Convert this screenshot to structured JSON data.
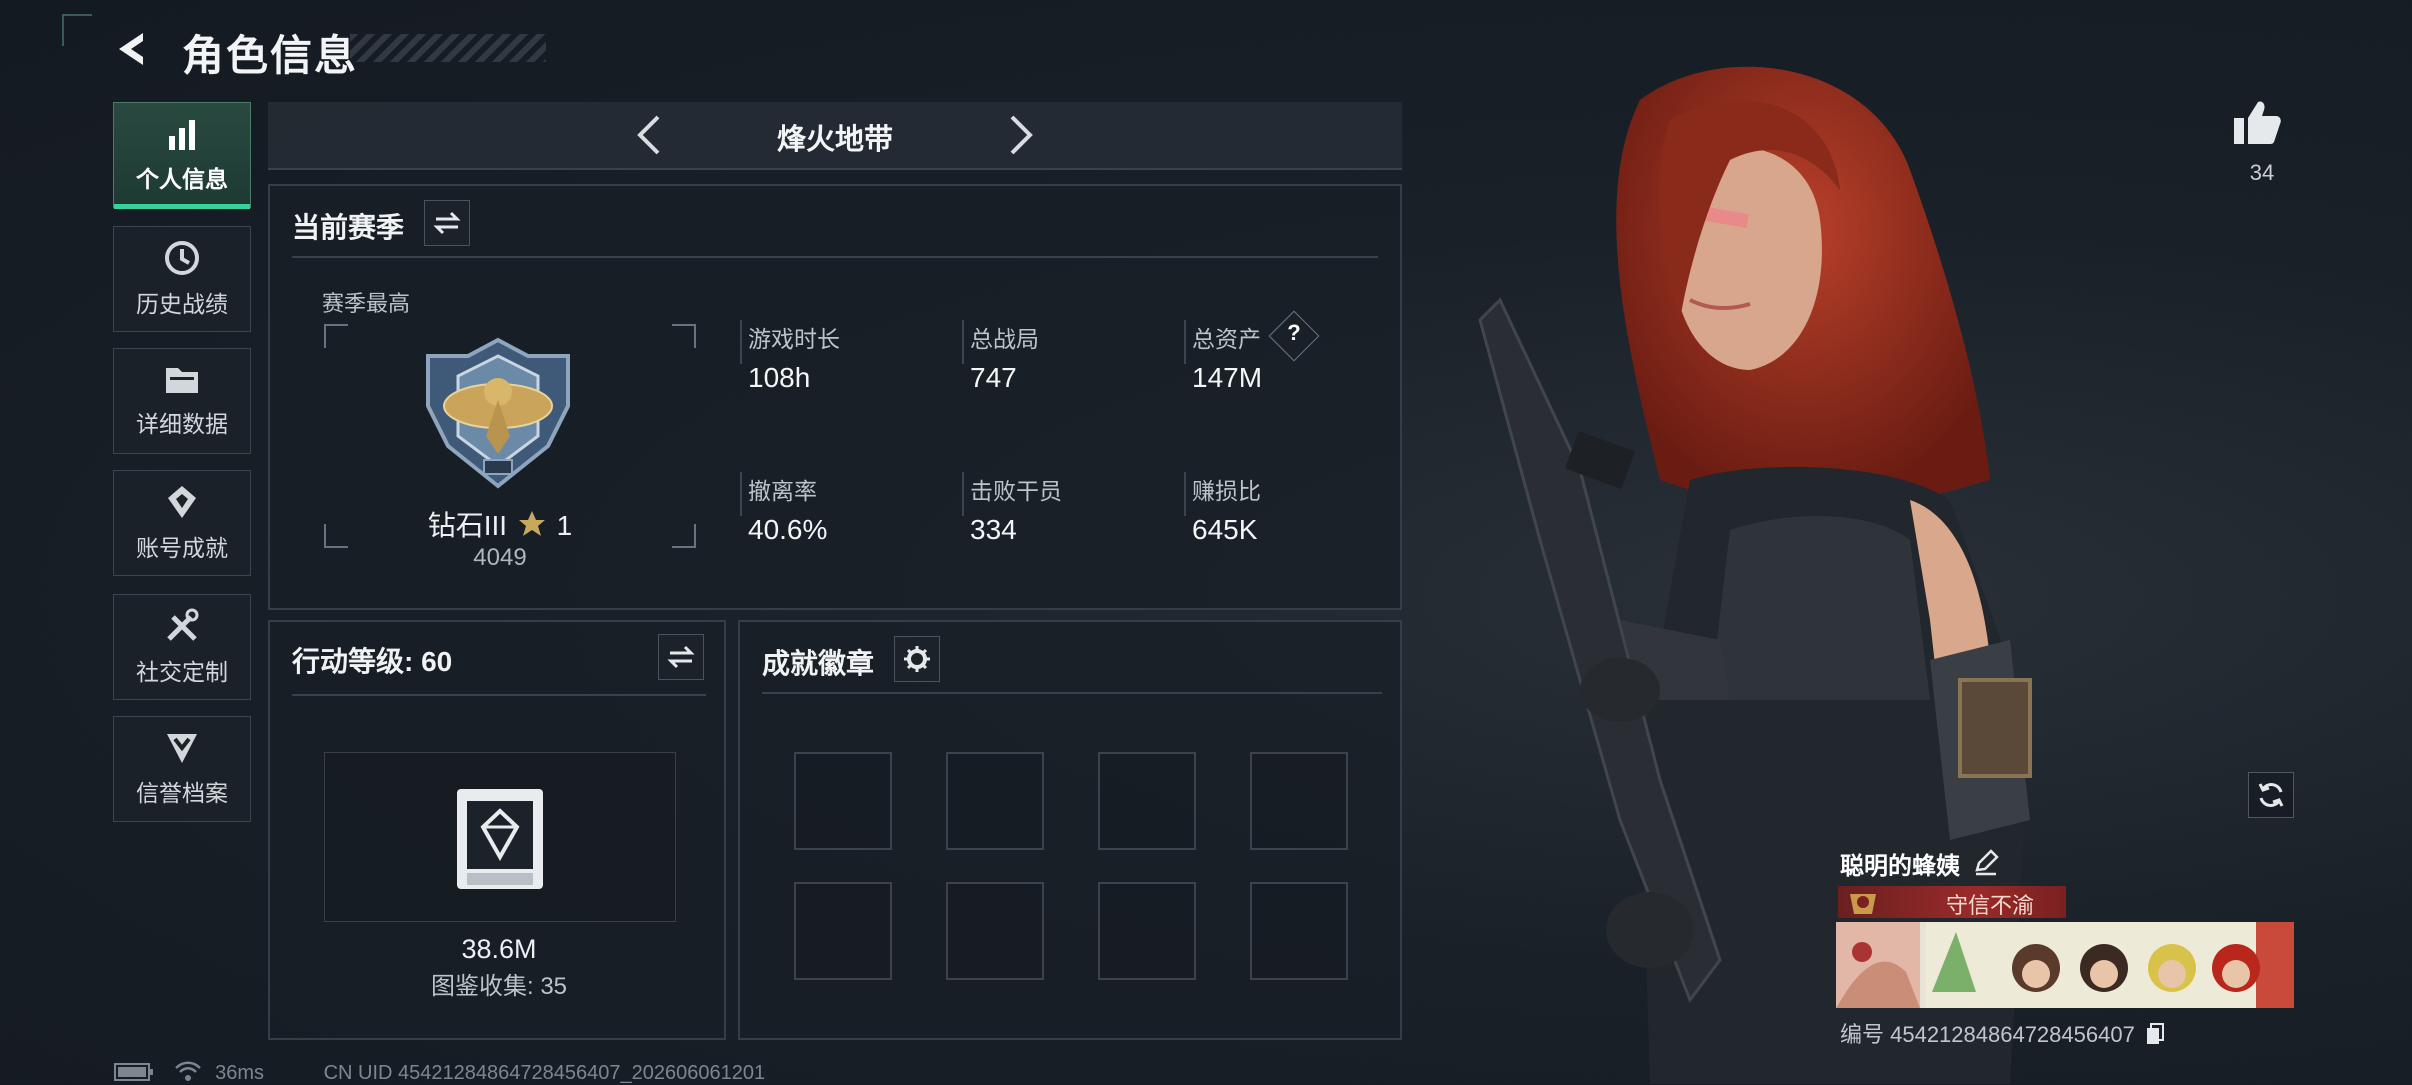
{
  "header": {
    "title": "角色信息"
  },
  "nav": {
    "items": [
      {
        "label": "个人信息",
        "icon": "bar-chart-icon",
        "active": true
      },
      {
        "label": "历史战绩",
        "icon": "history-clock-icon"
      },
      {
        "label": "详细数据",
        "icon": "folder-icon"
      },
      {
        "label": "账号成就",
        "icon": "achievement-icon"
      },
      {
        "label": "社交定制",
        "icon": "tools-icon"
      },
      {
        "label": "信誉档案",
        "icon": "shield-chevron-icon"
      }
    ]
  },
  "mode": {
    "title": "烽火地带"
  },
  "season": {
    "header": "当前赛季",
    "best_label": "赛季最高",
    "rank_name": "钻石III",
    "rank_stars": "1",
    "rank_points": "4049",
    "stats": [
      {
        "label": "游戏时长",
        "value": "108h"
      },
      {
        "label": "总战局",
        "value": "747"
      },
      {
        "label": "总资产",
        "value": "147M",
        "help": "?"
      },
      {
        "label": "撤离率",
        "value": "40.6%"
      },
      {
        "label": "击败干员",
        "value": "334"
      },
      {
        "label": "赚损比",
        "value": "645K"
      }
    ]
  },
  "action_level": {
    "header": "行动等级: 60",
    "value": "38.6M",
    "collection": "图鉴收集: 35"
  },
  "badges": {
    "header": "成就徽章",
    "slots": 8
  },
  "profile": {
    "likes": "34",
    "name": "聪明的蜂姨",
    "honor_title": "守信不渝",
    "id_text": "编号 4542128486472845640​7"
  },
  "status": {
    "ping": "36ms",
    "uid": "CN UID 45421284864728456407_202606061201"
  },
  "colors": {
    "accent": "#37d39a",
    "honor": "#9a2a2a"
  }
}
